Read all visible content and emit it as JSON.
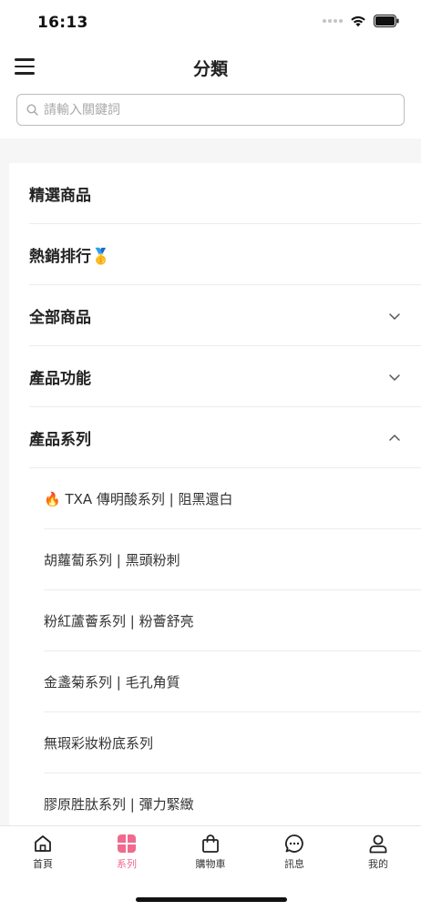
{
  "status": {
    "time": "16:13"
  },
  "header": {
    "title": "分類"
  },
  "search": {
    "placeholder": "請輸入關鍵詞"
  },
  "menu": {
    "items": [
      {
        "label": "精選商品"
      },
      {
        "label": "熱銷排行🥇"
      },
      {
        "label": "全部商品"
      },
      {
        "label": "產品功能"
      },
      {
        "label": "產品系列"
      }
    ],
    "series": [
      {
        "label": "🔥 TXA 傳明酸系列 | 阻黑還白"
      },
      {
        "label": "胡蘿蔔系列 | 黑頭粉刺"
      },
      {
        "label": "粉紅蘆薈系列 | 粉薈舒亮"
      },
      {
        "label": "金盞菊系列 | 毛孔角質"
      },
      {
        "label": "無瑕彩妝粉底系列"
      },
      {
        "label": "膠原胜肽系列 | 彈力緊緻"
      }
    ]
  },
  "tabs": [
    {
      "label": "首頁"
    },
    {
      "label": "系列"
    },
    {
      "label": "購物車"
    },
    {
      "label": "訊息"
    },
    {
      "label": "我的"
    }
  ],
  "colors": {
    "accent": "#f06a8d",
    "text": "#222222",
    "divider": "#ececec",
    "background": "#f6f6f6"
  },
  "icons": [
    "menu-icon",
    "search-icon",
    "chevron-down-icon",
    "chevron-up-icon",
    "home-icon",
    "grid-icon",
    "shopping-bag-icon",
    "chat-icon",
    "user-icon"
  ]
}
